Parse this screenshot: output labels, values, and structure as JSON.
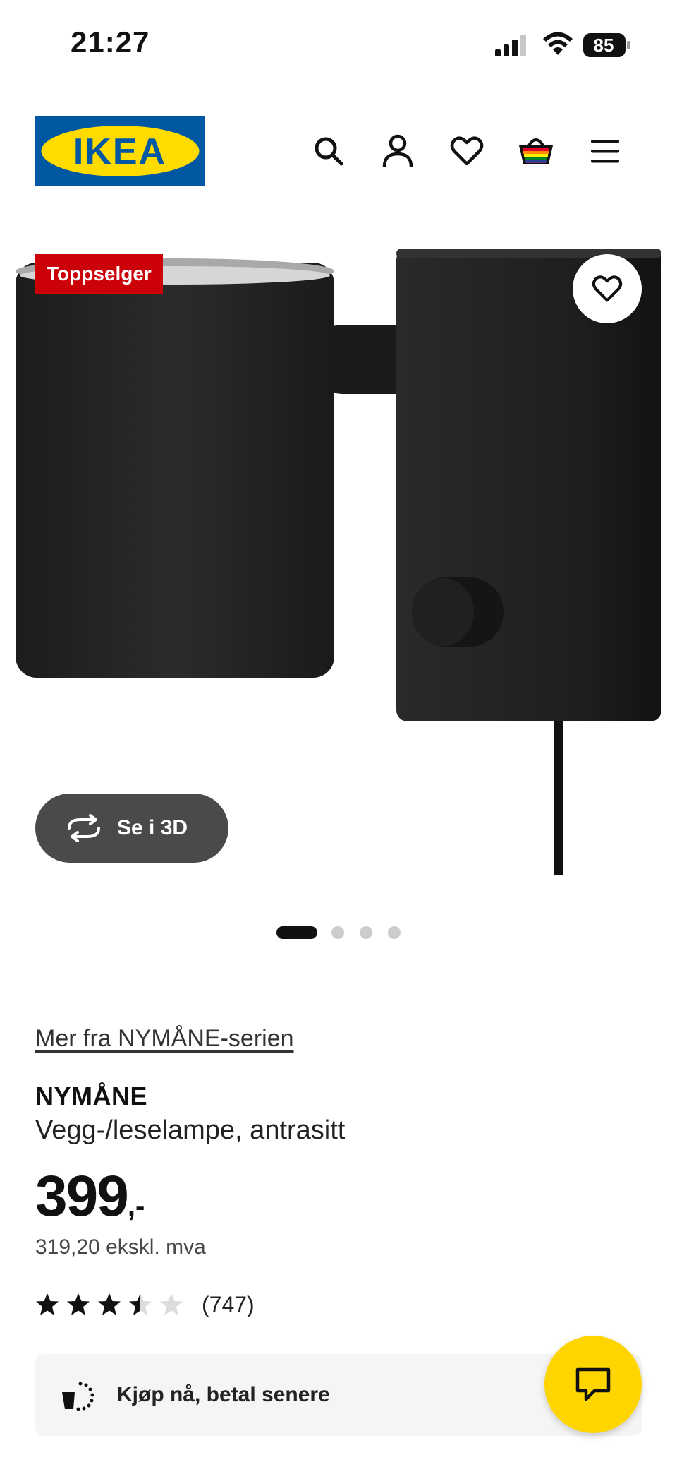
{
  "status_bar": {
    "time": "21:27",
    "battery": "85"
  },
  "header": {
    "logo_text": "IKEA",
    "icons": [
      "search-icon",
      "account-icon",
      "heart-icon",
      "basket-icon",
      "menu-icon"
    ]
  },
  "gallery": {
    "badge": "Toppselger",
    "view_3d_label": "Se i 3D",
    "image_count": 4,
    "active_image": 1
  },
  "product": {
    "series_link": "Mer fra NYMÅNE-serien",
    "name": "NYMÅNE",
    "description": "Vegg-/leselampe, antrasitt",
    "price": "399",
    "price_suffix": ",-",
    "price_excl_vat": "319,20 ekskl. mva",
    "rating": {
      "stars": 3.5,
      "max": 5,
      "count": "(747)"
    }
  },
  "bnpl": {
    "label": "Kjøp nå, betal senere"
  },
  "colors": {
    "brand_blue": "#0058a3",
    "brand_yellow": "#ffdb00",
    "badge_red": "#cc0008",
    "chat_yellow": "#ffd500"
  }
}
